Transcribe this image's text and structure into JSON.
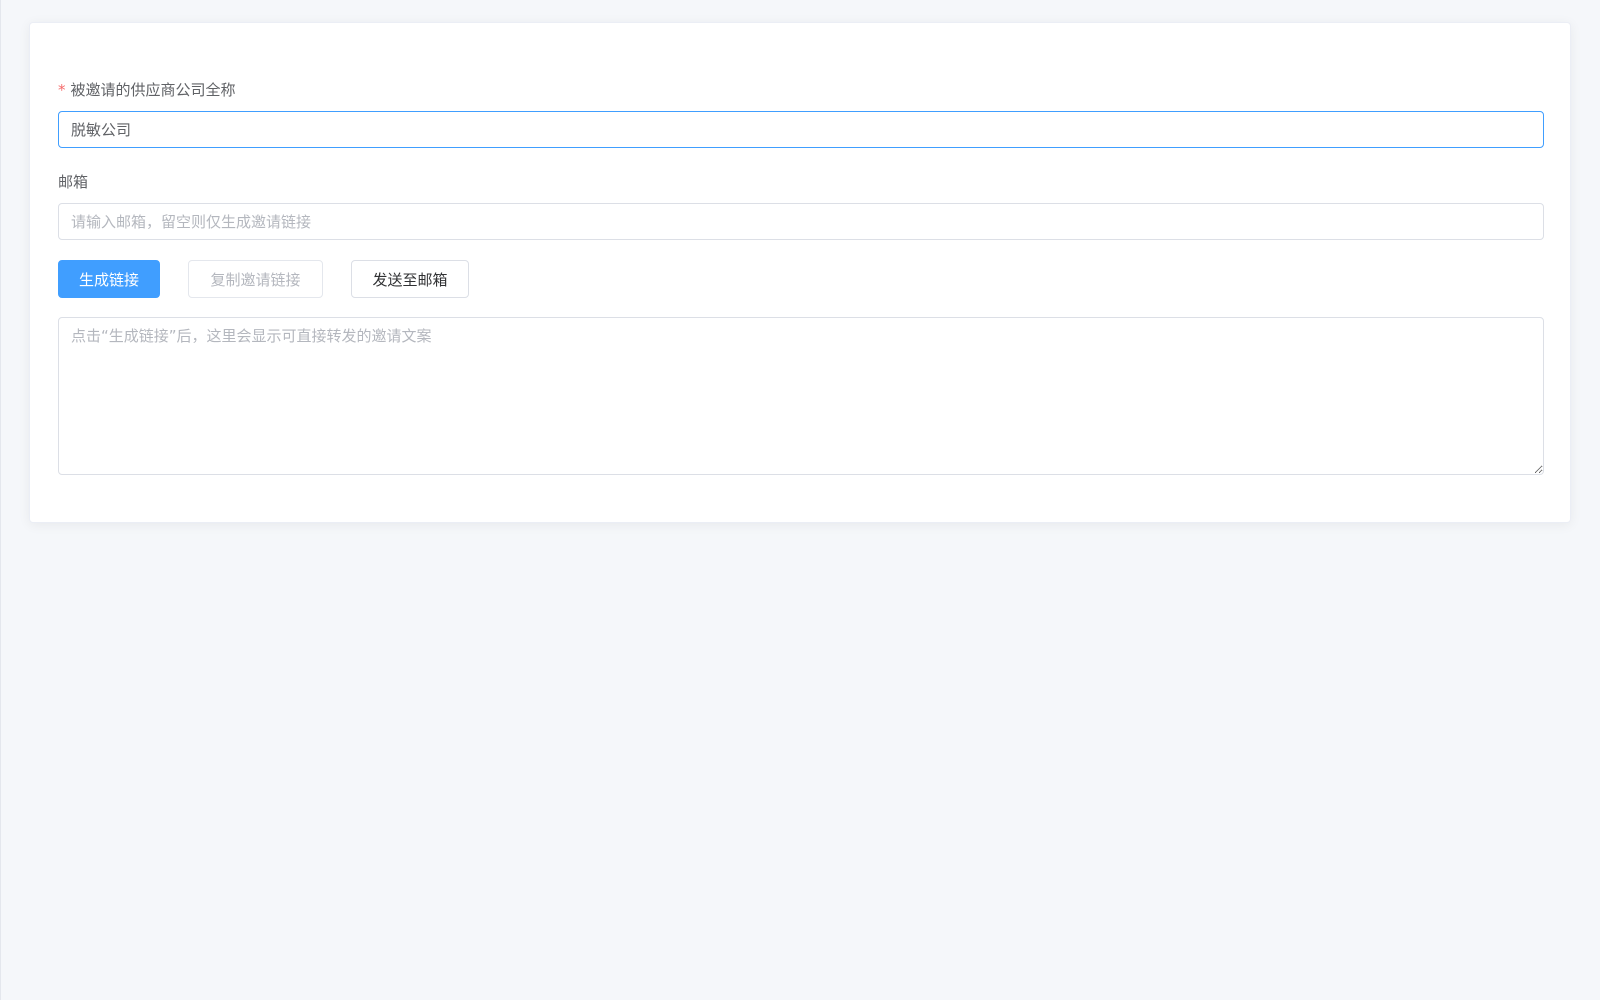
{
  "form": {
    "company": {
      "required_mark": "*",
      "label": "被邀请的供应商公司全称",
      "value": "脱敏公司"
    },
    "email": {
      "label": "邮箱",
      "value": "",
      "placeholder": "请输入邮箱，留空则仅生成邀请链接"
    },
    "buttons": {
      "generate": "生成链接",
      "copy": "复制邀请链接",
      "send": "发送至邮箱"
    },
    "invite_text": {
      "value": "",
      "placeholder": "点击“生成链接”后，这里会显示可直接转发的邀请文案"
    }
  },
  "colors": {
    "primary": "#409eff",
    "required": "#f56c6c",
    "background": "#f5f7fa"
  }
}
